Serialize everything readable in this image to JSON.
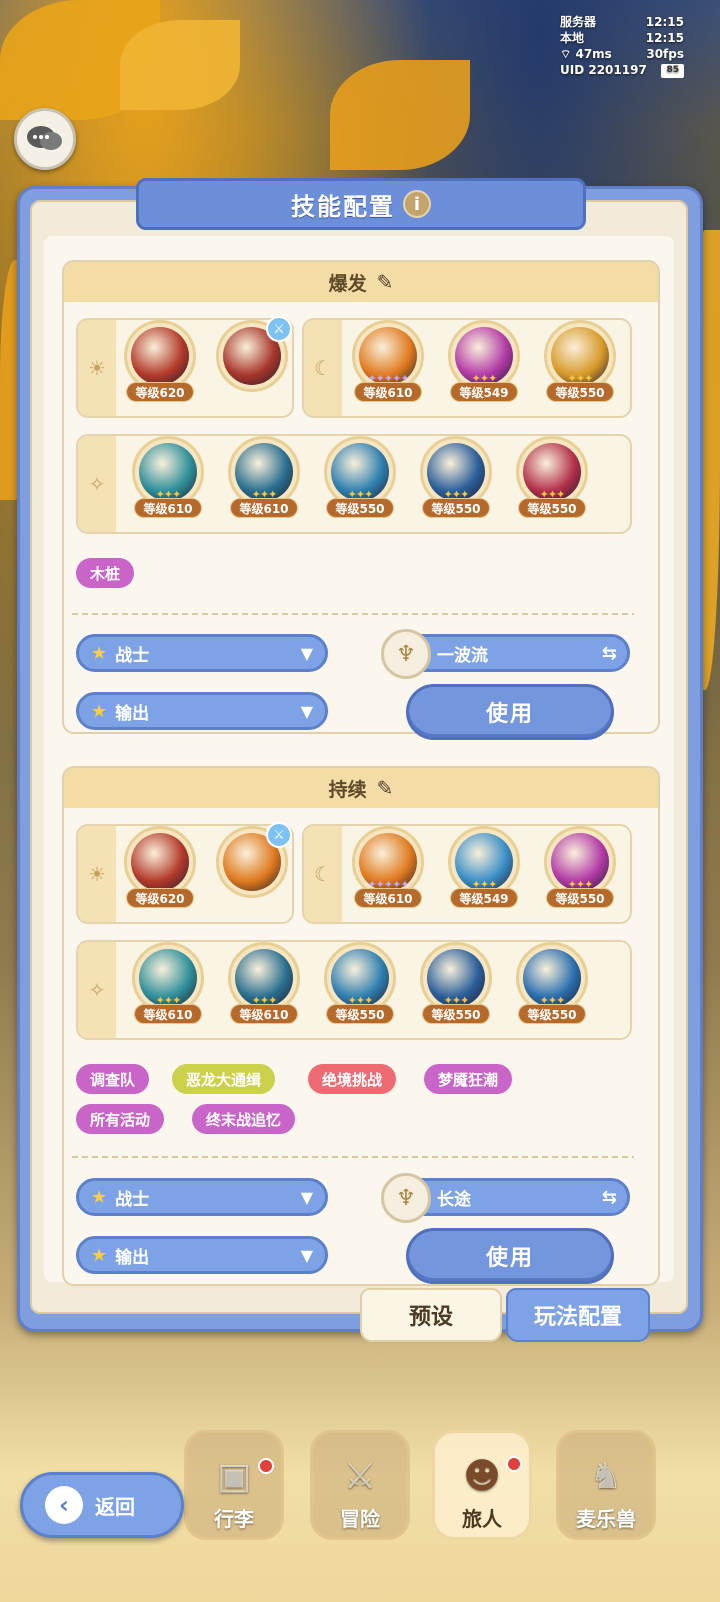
{
  "status": {
    "server_label": "服务器",
    "server_time": "12:15",
    "local_label": "本地",
    "local_time": "12:15",
    "ping": "47ms",
    "fps": "30fps",
    "uid": "UID 2201197",
    "battery": "85"
  },
  "panel": {
    "title": "技能配置",
    "info": "i"
  },
  "sections": [
    {
      "title": "爆发",
      "sun_skills": [
        {
          "icon": "crossed-swords-icon",
          "level": "等级620",
          "color": "#b33a2a"
        },
        {
          "icon": "crossed-swords-icon",
          "level": "",
          "color": "#a8362b",
          "badge": "sword-badge-icon"
        }
      ],
      "moon_skills": [
        {
          "icon": "flame-warrior-icon",
          "level": "等级610",
          "color": "#e07a1f"
        },
        {
          "icon": "target-icon",
          "level": "等级549",
          "color": "#b23aa6"
        },
        {
          "icon": "aura-warrior-icon",
          "level": "等级550",
          "color": "#d89a2a"
        }
      ],
      "star_skills": [
        {
          "icon": "skull-shield-icon",
          "level": "等级610",
          "color": "#2f8f9a"
        },
        {
          "icon": "arrow-up-shield-icon",
          "level": "等级610",
          "color": "#2a6f8f"
        },
        {
          "icon": "claw-icon",
          "level": "等级550",
          "color": "#2f7fb0"
        },
        {
          "icon": "power-up-icon",
          "level": "等级550",
          "color": "#2b5f9a"
        },
        {
          "icon": "rage-icon",
          "level": "等级550",
          "color": "#b3304b"
        }
      ],
      "tags": [
        {
          "label": "木桩",
          "color": "#c964c8"
        }
      ],
      "class": "战士",
      "role": "输出",
      "flow": "一波流",
      "use": "使用"
    },
    {
      "title": "持续",
      "sun_skills": [
        {
          "icon": "crossed-swords-icon",
          "level": "等级620",
          "color": "#b33a2a"
        },
        {
          "icon": "flame-warrior-icon",
          "level": "",
          "color": "#e07a1f",
          "badge": "sword-badge-icon"
        }
      ],
      "moon_skills": [
        {
          "icon": "flame-warrior-icon",
          "level": "等级610",
          "color": "#e07a1f"
        },
        {
          "icon": "lance-icon",
          "level": "等级549",
          "color": "#3a8fc7"
        },
        {
          "icon": "target-icon",
          "level": "等级550",
          "color": "#b23aa6"
        }
      ],
      "star_skills": [
        {
          "icon": "skull-shield-icon",
          "level": "等级610",
          "color": "#2f8f9a"
        },
        {
          "icon": "arrow-up-shield-icon",
          "level": "等级610",
          "color": "#2a6f8f"
        },
        {
          "icon": "claw-icon",
          "level": "等级550",
          "color": "#2f7fb0"
        },
        {
          "icon": "power-up-icon",
          "level": "等级550",
          "color": "#2b5f9a"
        },
        {
          "icon": "blades-icon",
          "level": "等级550",
          "color": "#2a6fae"
        }
      ],
      "tags": [
        {
          "label": "调查队",
          "color": "#c964c8"
        },
        {
          "label": "恶龙大通缉",
          "color": "#cbd14a"
        },
        {
          "label": "绝境挑战",
          "color": "#ef6b73"
        },
        {
          "label": "梦魇狂潮",
          "color": "#c964c8"
        },
        {
          "label": "所有活动",
          "color": "#c964c8"
        },
        {
          "label": "终末战追忆",
          "color": "#c964c8"
        }
      ],
      "class": "战士",
      "role": "输出",
      "flow": "长途",
      "use": "使用"
    }
  ],
  "bottom_tabs": {
    "preset": "预设",
    "play_config": "玩法配置"
  },
  "nav": [
    {
      "label": "行李",
      "icon": "chest-icon"
    },
    {
      "label": "冒险",
      "icon": "crossed-swords-icon"
    },
    {
      "label": "旅人",
      "icon": "traveler-icon"
    },
    {
      "label": "麦乐兽",
      "icon": "fox-icon"
    }
  ],
  "back": "返回"
}
